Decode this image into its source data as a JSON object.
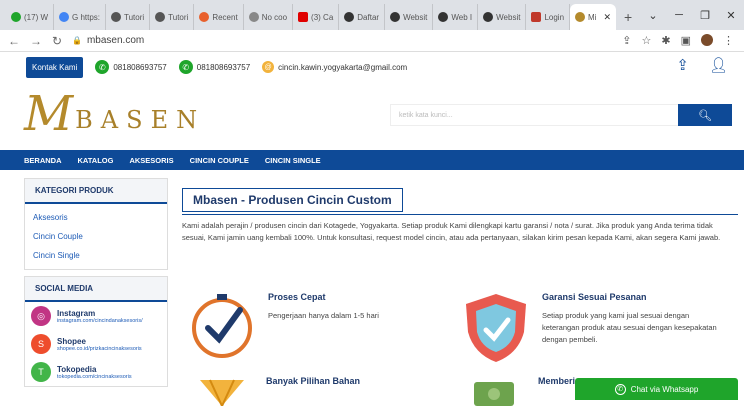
{
  "browser": {
    "tabs": [
      {
        "label": "(17) W",
        "color": "#1fa52b"
      },
      {
        "label": "G https:",
        "color": "#4285f4"
      },
      {
        "label": "Tutori",
        "color": "#555555"
      },
      {
        "label": "Tutori",
        "color": "#555555"
      },
      {
        "label": "Recent",
        "color": "#e8602c"
      },
      {
        "label": "No coo",
        "color": "#888888"
      },
      {
        "label": "(3) Ca",
        "color": "#e00000"
      },
      {
        "label": "Daftar",
        "color": "#333333"
      },
      {
        "label": "Websit",
        "color": "#333333"
      },
      {
        "label": "Web I",
        "color": "#333333"
      },
      {
        "label": "Websit",
        "color": "#333333"
      },
      {
        "label": "Login",
        "color": "#c0392b"
      },
      {
        "label": "Mi",
        "color": "#b48a2c"
      }
    ],
    "new_tab": "+",
    "url": "mbasen.com"
  },
  "topbar": {
    "kontak_label": "Kontak Kami",
    "phone1": "081808693757",
    "phone2": "081808693757",
    "email": "cincin.kawin.yogyakarta@gmail.com"
  },
  "logo": {
    "initial": "M",
    "text": "MBASEN"
  },
  "search": {
    "placeholder": "ketik kata kunci..."
  },
  "nav": [
    "BERANDA",
    "KATALOG",
    "AKSESORIS",
    "CINCIN COUPLE",
    "CINCIN SINGLE"
  ],
  "sidebar": {
    "kategori_title": "KATEGORI PRODUK",
    "kategori": [
      "Aksesoris",
      "Cincin Couple",
      "Cincin Single"
    ],
    "social_title": "SOCIAL MEDIA",
    "social": [
      {
        "name": "Instagram",
        "url": "instagram.com/cincindanaksesoris/",
        "color": "#c13584"
      },
      {
        "name": "Shopee",
        "url": "shopee.co.id/prizkacincinaksesoris",
        "color": "#ee4d2d"
      },
      {
        "name": "Tokopedia",
        "url": "tokopedia.com/cincinaksesoris",
        "color": "#42b549"
      }
    ]
  },
  "main": {
    "title": "Mbasen - Produsen Cincin Custom",
    "intro": "Kami adalah perajin / produsen cincin dari Kotagede, Yogyakarta. Setiap produk Kami dilengkapi kartu garansi / nota / surat. Jika produk yang Anda terima tidak sesuai, Kami jamin uang kembali 100%. Untuk konsultasi, request model cincin, atau ada pertanyaan, silakan kirim pesan kepada Kami, akan segera Kami jawab.",
    "features": [
      {
        "title": "Proses Cepat",
        "desc": "Pengerjaan hanya dalam 1-5 hari"
      },
      {
        "title": "Garansi Sesuai Pesanan",
        "desc": "Setiap produk yang kami jual sesuai dengan keterangan produk atau sesuai dengan kesepakatan dengan pembeli."
      },
      {
        "title": "Banyak Pilihan Bahan",
        "desc": ""
      },
      {
        "title": "Memberi",
        "desc": ""
      }
    ]
  },
  "whatsapp_button": "Chat via Whatsapp"
}
